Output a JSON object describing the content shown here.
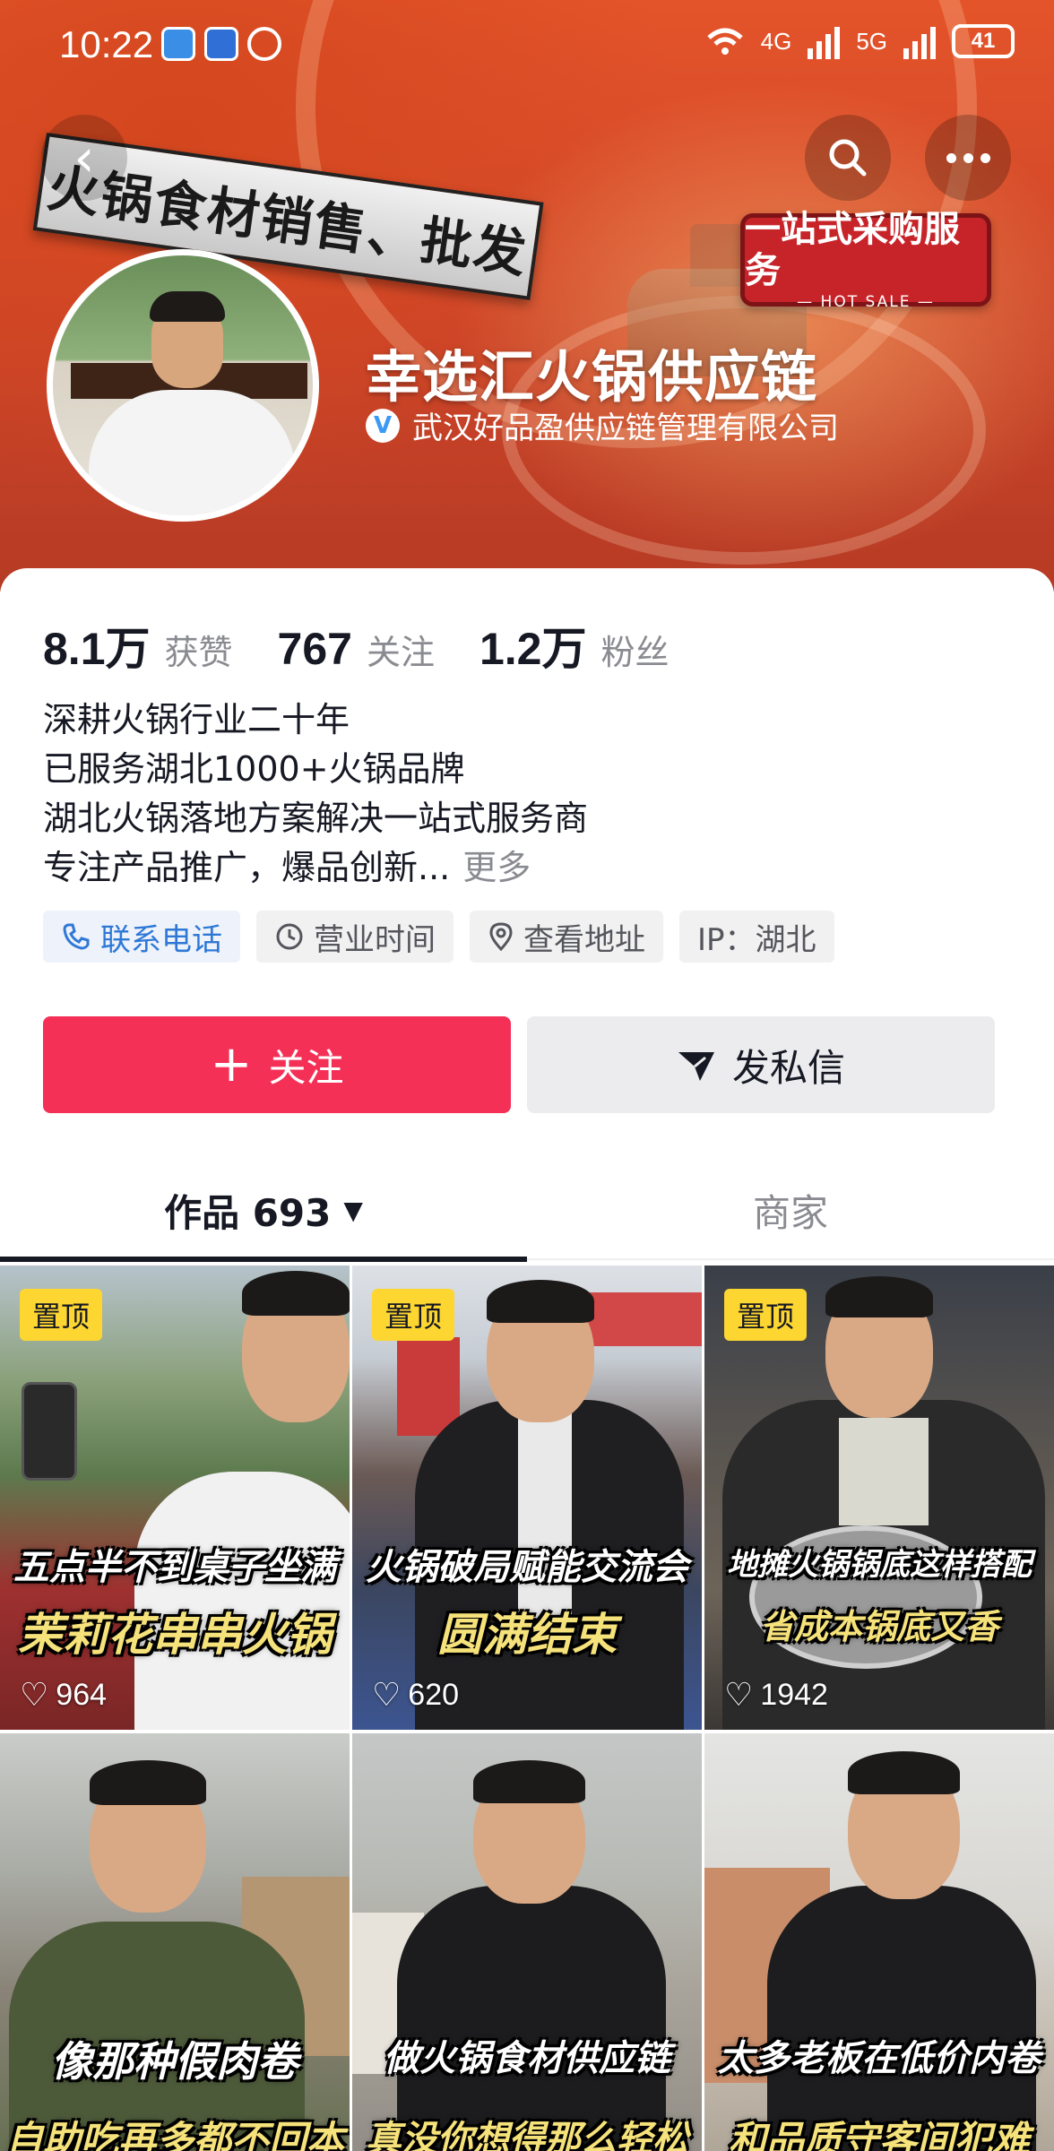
{
  "status_bar": {
    "time": "10:22",
    "network_1": "4G",
    "network_2": "5G",
    "battery": "41"
  },
  "header": {
    "banner_slogan": "火锅食材销售、批发",
    "service_sign_main": "一站式采购服务",
    "service_sign_sub": "— HOT SALE —",
    "profile_name": "幸选汇火锅供应链",
    "verify_mark": "V",
    "company_name": "武汉好品盈供应链管理有限公司"
  },
  "stats": [
    {
      "value": "8.1万",
      "label": "获赞"
    },
    {
      "value": "767",
      "label": "关注"
    },
    {
      "value": "1.2万",
      "label": "粉丝"
    }
  ],
  "bio": {
    "lines": [
      "深耕火锅行业二十年",
      "已服务湖北1000+火锅品牌",
      "湖北火锅落地方案解决一站式服务商",
      "专注产品推广，爆品创新..."
    ],
    "more": "更多"
  },
  "tags": [
    {
      "icon": "phone-icon",
      "label": "联系电话"
    },
    {
      "icon": "clock-icon",
      "label": "营业时间"
    },
    {
      "icon": "location-icon",
      "label": "查看地址"
    },
    {
      "icon": "",
      "label": "IP：湖北"
    }
  ],
  "actions": {
    "follow": "关注",
    "message": "发私信"
  },
  "tabs": {
    "works": "作品 693",
    "merchant": "商家"
  },
  "videos": [
    {
      "pinned": "置顶",
      "line1": "五点半不到桌子坐满",
      "line2": "茉莉花串串火锅",
      "likes": "964"
    },
    {
      "pinned": "置顶",
      "line1": "火锅破局赋能交流会",
      "line2": "圆满结束",
      "likes": "620"
    },
    {
      "pinned": "置顶",
      "line1": "地摊火锅锅底这样搭配",
      "line2": "省成本锅底又香",
      "likes": "1942"
    },
    {
      "pinned": "",
      "line1": "像那种假肉卷",
      "line2": "自助吃再多都不回本",
      "likes": ""
    },
    {
      "pinned": "",
      "line1": "做火锅食材供应链",
      "line2": "真没你想得那么轻松",
      "likes": ""
    },
    {
      "pinned": "",
      "line1": "太多老板在低价内卷",
      "line2": "和品质守客间犯难",
      "likes": ""
    }
  ],
  "colors": {
    "follow_button": "#f53057",
    "pin_badge": "#fdd631",
    "banner": "#d2482a"
  }
}
